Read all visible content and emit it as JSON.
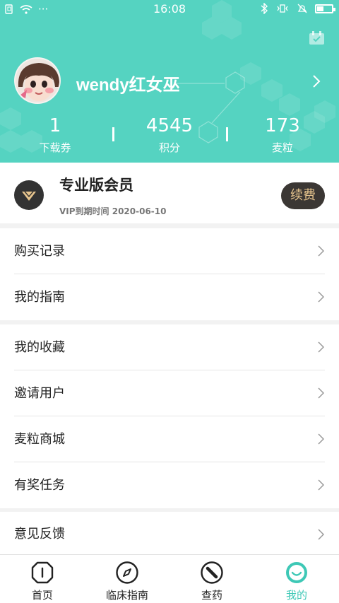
{
  "status_bar": {
    "time": "16:08",
    "dots": "···",
    "battery_level": 0.45
  },
  "profile": {
    "username": "wendy红女巫"
  },
  "stats": [
    {
      "value": "1",
      "label": "下载券"
    },
    {
      "value": "4545",
      "label": "积分"
    },
    {
      "value": "173",
      "label": "麦粒"
    }
  ],
  "vip": {
    "title": "专业版会员",
    "expire": "VIP到期时间 2020-06-10",
    "renew_label": "续费"
  },
  "menu": {
    "purchase_records": "购买记录",
    "my_guide": "我的指南",
    "my_favorites": "我的收藏",
    "invite_users": "邀请用户",
    "maili_mall": "麦粒商城",
    "reward_tasks": "有奖任务",
    "feedback": "意见反馈"
  },
  "tabs": [
    {
      "label": "首页",
      "icon": "home-icon"
    },
    {
      "label": "临床指南",
      "icon": "compass-icon"
    },
    {
      "label": "查药",
      "icon": "pill-icon"
    },
    {
      "label": "我的",
      "icon": "smile-icon"
    }
  ],
  "colors": {
    "accent": "#55d3c1",
    "tab_active": "#3ec8b6",
    "vip_gold": "#e7c58e",
    "vip_dark": "#3b3734"
  }
}
